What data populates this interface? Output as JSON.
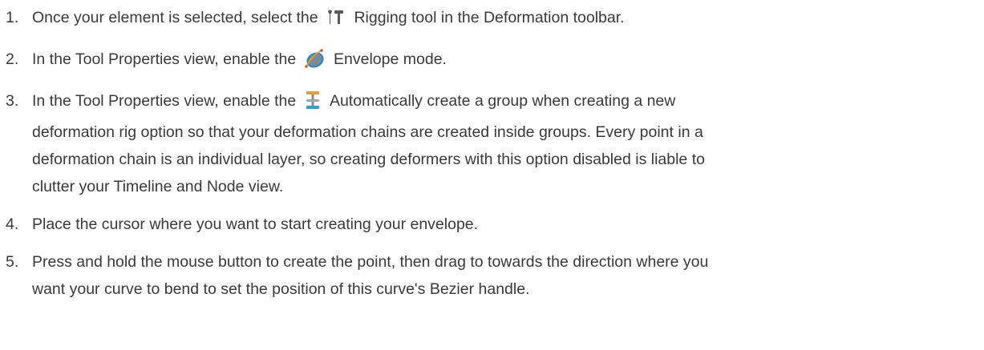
{
  "steps": [
    {
      "number": "1.",
      "before": "Once your element is selected, select the",
      "icon": "rigging-tool-icon",
      "after": "Rigging tool in the Deformation toolbar."
    },
    {
      "number": "2.",
      "before": "In the Tool Properties view, enable the",
      "icon": "envelope-mode-icon",
      "after": "Envelope mode."
    },
    {
      "number": "3.",
      "before": "In the Tool Properties view, enable the",
      "icon": "create-group-icon",
      "after": "Automatically create a group when creating a new",
      "line2": "deformation rig option so that your deformation chains are created inside groups. Every point in a",
      "line3": "deformation chain is an individual layer, so creating deformers with this option disabled is liable to",
      "line4": "clutter your Timeline and Node view."
    },
    {
      "number": "4.",
      "text": "Place the cursor where you want to start creating your envelope."
    },
    {
      "number": "5.",
      "line1": "Press and hold the mouse button to create the point, then drag to towards the direction where you",
      "line2": "want your curve to bend to set the position of this curve's Bezier handle."
    }
  ]
}
